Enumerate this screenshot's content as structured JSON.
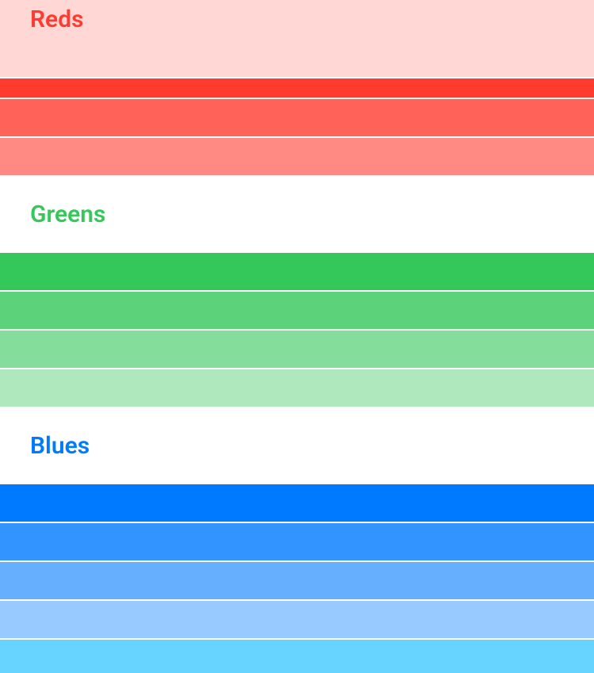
{
  "sections": {
    "reds": {
      "label": "Reds",
      "labelColor": "#ff3b30",
      "headerBackground": "#ffd8d6",
      "preBand": "#ffd8d6",
      "bands": [
        "#ff3b30",
        "#ff6259",
        "#ff8983"
      ]
    },
    "greens": {
      "label": "Greens",
      "labelColor": "#34c759",
      "headerBackground": "#ffffff",
      "bands": [
        "#34c759",
        "#5cd27a",
        "#85dd9b",
        "#aee8bc"
      ]
    },
    "blues": {
      "label": "Blues",
      "labelColor": "#007aff",
      "headerBackground": "#ffffff",
      "bands": [
        "#007aff",
        "#3294ff",
        "#66afff",
        "#99caff",
        "#66d4ff"
      ]
    }
  }
}
